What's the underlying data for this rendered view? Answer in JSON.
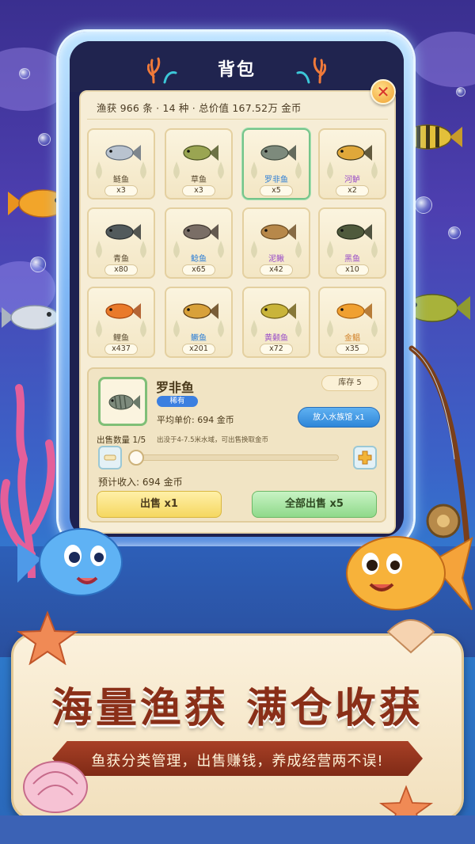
{
  "panel": {
    "title": "背包",
    "close_symbol": "✕",
    "stats": "渔获 966 条 · 14 种 · 总价值 167.52万 金币"
  },
  "fish_grid": [
    {
      "name": "鲢鱼",
      "count": "x3",
      "name_color": "#5a4a30"
    },
    {
      "name": "草鱼",
      "count": "x3",
      "name_color": "#5a4a30"
    },
    {
      "name": "罗非鱼",
      "count": "x5",
      "name_color": "#2f7fd6"
    },
    {
      "name": "河鲈",
      "count": "x2",
      "name_color": "#9b4fc8"
    },
    {
      "name": "青鱼",
      "count": "x80",
      "name_color": "#5a4a30"
    },
    {
      "name": "鲶鱼",
      "count": "x65",
      "name_color": "#2f7fd6"
    },
    {
      "name": "泥鳅",
      "count": "x42",
      "name_color": "#9b4fc8"
    },
    {
      "name": "黑鱼",
      "count": "x10",
      "name_color": "#9b4fc8"
    },
    {
      "name": "鲤鱼",
      "count": "x437",
      "name_color": "#5a4a30"
    },
    {
      "name": "鳜鱼",
      "count": "x201",
      "name_color": "#2f7fd6"
    },
    {
      "name": "黄颡鱼",
      "count": "x72",
      "name_color": "#9b4fc8"
    },
    {
      "name": "金鲳",
      "count": "x35",
      "name_color": "#d2822a"
    }
  ],
  "detail": {
    "name": "罗非鱼",
    "rarity": "稀有",
    "stock": "库存 5",
    "avg_price": "平均单价: 694 金币",
    "aquarium_button": "放入水族馆 x1",
    "quantity_label": "出售数量 1/5",
    "hint": "出没于4-7.5米水域，可出售换取金币",
    "quantity_fraction": 0.2,
    "revenue": "预计收入: 694 金币",
    "sell_button": "出售 x1",
    "sell_all_button": "全部出售 x5"
  },
  "promo": {
    "headline": "海量渔获 满仓收获",
    "subline": "鱼获分类管理，出售赚钱，养成经营两不误!"
  },
  "colors": {
    "panel_bg": "#f6edd6",
    "selected_border": "#74c48a",
    "accent_blue": "#2e86d8",
    "headline": "#8a2f18"
  }
}
